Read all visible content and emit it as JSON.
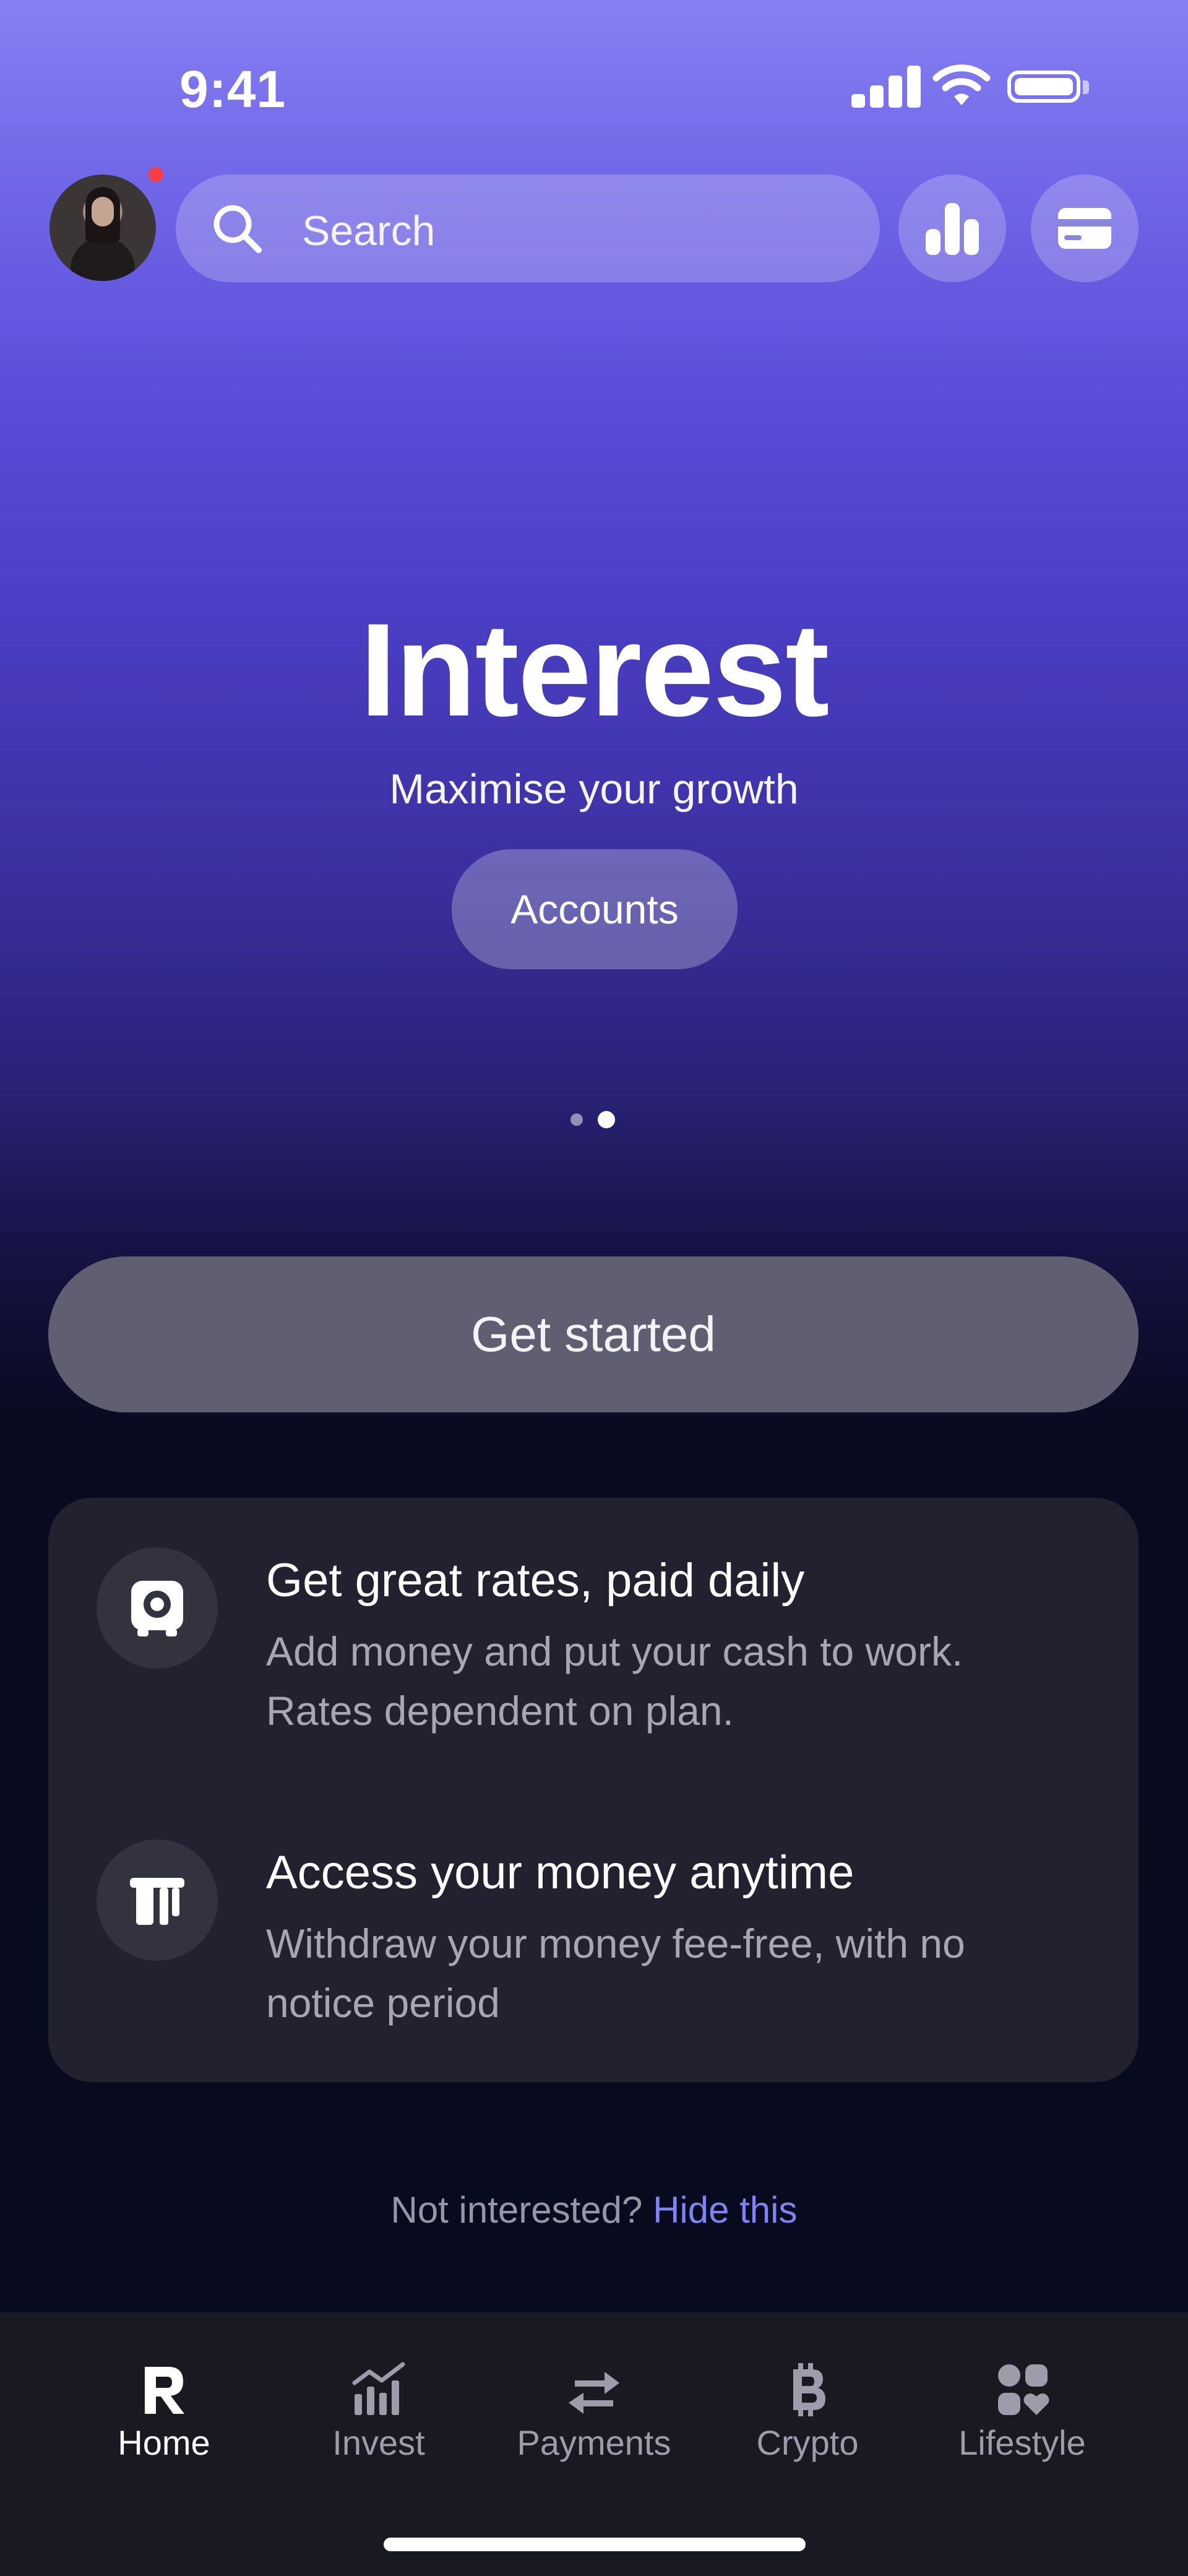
{
  "status_bar": {
    "time": "9:41",
    "icons": [
      "cellular-signal-icon",
      "wifi-icon",
      "battery-icon"
    ]
  },
  "header": {
    "search_placeholder": "Search",
    "icons": [
      "avatar",
      "search-icon",
      "bar-chart-icon",
      "card-icon"
    ],
    "notification_color": "#ff3b47"
  },
  "hero": {
    "title": "Interest",
    "subtitle": "Maximise your growth",
    "pill_label": "Accounts",
    "carousel": {
      "count": 2,
      "active": 2
    }
  },
  "cta": {
    "label": "Get started"
  },
  "features": [
    {
      "icon": "safe-icon",
      "title": "Get great rates, paid daily",
      "description": "Add money and put your cash to work. Rates dependent on plan."
    },
    {
      "icon": "withdraw-icon",
      "title": "Access your money anytime",
      "description": "Withdraw your money fee-free, with no notice period"
    }
  ],
  "footer": {
    "prompt": "Not interested?",
    "link": "Hide this",
    "link_color": "#7d84f2"
  },
  "tabbar": {
    "tabs": [
      {
        "label": "Home",
        "icon": "revolut-r-icon",
        "active": true
      },
      {
        "label": "Invest",
        "icon": "invest-chart-icon",
        "active": false
      },
      {
        "label": "Payments",
        "icon": "transfer-arrows-icon",
        "active": false
      },
      {
        "label": "Crypto",
        "icon": "bitcoin-icon",
        "active": false
      },
      {
        "label": "Lifestyle",
        "icon": "lifestyle-grid-icon",
        "active": false
      }
    ]
  },
  "colors": {
    "gradient_top": "#8580f3",
    "gradient_bottom": "#080a1c",
    "button_bg": "#605f72",
    "card_bg": "#21212f",
    "tabbar_bg": "#191922"
  }
}
